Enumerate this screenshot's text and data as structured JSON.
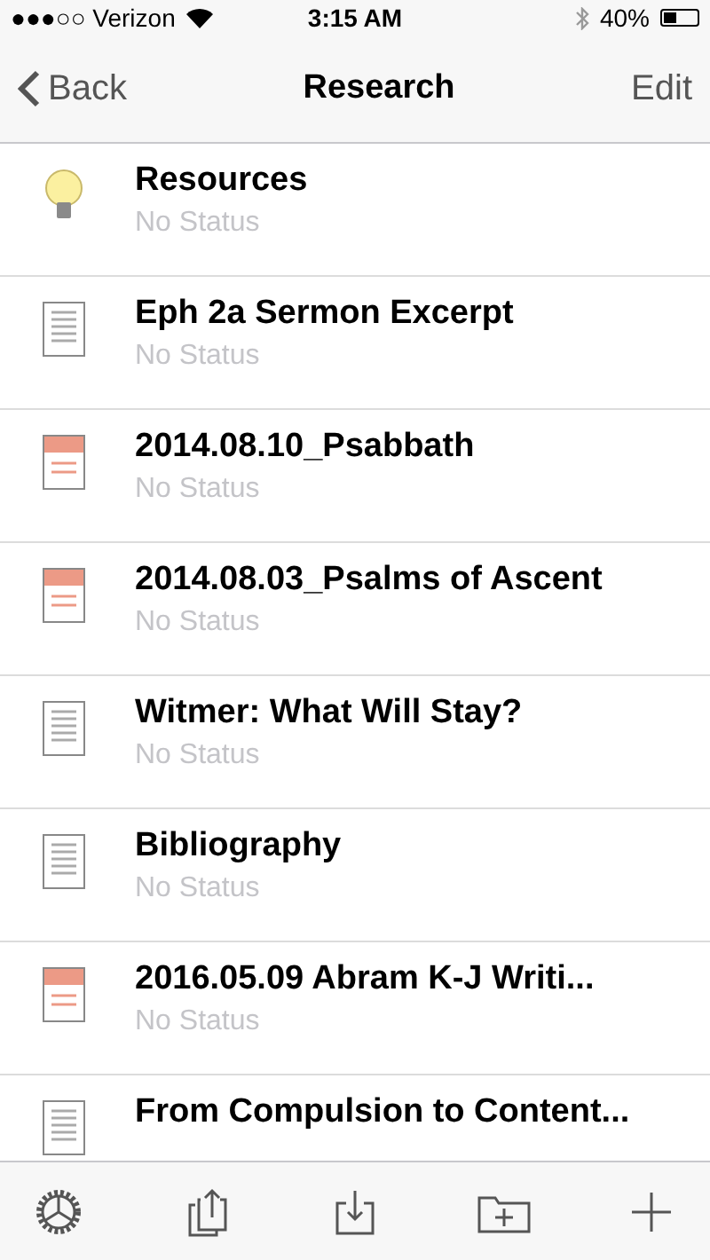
{
  "status_bar": {
    "carrier": "●●●○○ Verizon",
    "time": "3:15 AM",
    "battery": "40%"
  },
  "nav": {
    "back": "Back",
    "title": "Research",
    "edit": "Edit"
  },
  "items": [
    {
      "kind": "idea",
      "title": "Resources",
      "status": "No Status"
    },
    {
      "kind": "doc",
      "title": "Eph 2a Sermon Excerpt",
      "status": "No Status"
    },
    {
      "kind": "pdf",
      "title": "2014.08.10_Psabbath",
      "status": "No Status"
    },
    {
      "kind": "pdf",
      "title": "2014.08.03_Psalms of Ascent",
      "status": "No Status"
    },
    {
      "kind": "doc",
      "title": "Witmer: What Will Stay?",
      "status": "No Status"
    },
    {
      "kind": "doc",
      "title": "Bibliography",
      "status": "No Status"
    },
    {
      "kind": "pdf",
      "title": "2016.05.09 Abram K-J Writi...",
      "status": "No Status"
    },
    {
      "kind": "doc",
      "title": "From Compulsion to Content..."
    }
  ],
  "toolbar": [
    {
      "kind": "settings"
    },
    {
      "kind": "share"
    },
    {
      "kind": "import"
    },
    {
      "kind": "new-folder"
    },
    {
      "kind": "add"
    }
  ]
}
